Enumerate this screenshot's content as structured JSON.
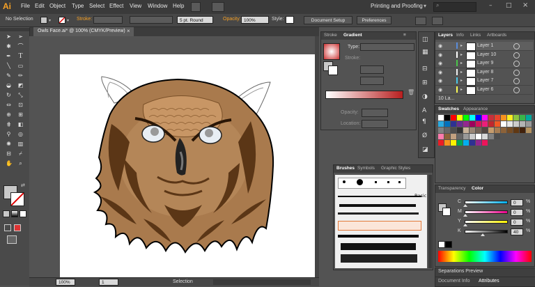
{
  "app": {
    "logo": "Ai"
  },
  "menu": [
    "File",
    "Edit",
    "Object",
    "Type",
    "Select",
    "Effect",
    "View",
    "Window",
    "Help"
  ],
  "workspace": {
    "label": "Printing and Proofing"
  },
  "control_bar": {
    "selection_label": "No Selection",
    "stroke_label": "Stroke:",
    "stroke_profile": "5 pt. Round",
    "opacity_label": "Opacity:",
    "opacity_value": "100%",
    "style_label": "Style:",
    "doc_setup": "Document Setup",
    "preferences": "Preferences"
  },
  "document": {
    "tab_title": "Owls Face.ai* @ 100% (CMYK/Preview)",
    "close": "×"
  },
  "status": {
    "zoom": "100%",
    "artboard": "1",
    "tool": "Selection"
  },
  "stroke_gradient_panel": {
    "tabs": [
      "Stroke",
      "Gradient"
    ],
    "type_label": "Type:",
    "stroke_label": "Stroke:",
    "opacity_label": "Opacity:",
    "location_label": "Location:"
  },
  "layers_panel": {
    "tabs": [
      "Layers",
      "Info",
      "Links",
      "Artboards"
    ],
    "layers": [
      "Layer 1",
      "Layer 10",
      "Layer 9",
      "Layer 8",
      "Layer 7",
      "Layer 6"
    ],
    "footer": "10 La..."
  },
  "swatches_panel": {
    "tabs": [
      "Swatches",
      "Appearance"
    ]
  },
  "brushes_panel": {
    "tabs": [
      "Brushes",
      "Symbols",
      "Graphic Styles"
    ],
    "basic_label": "Basic"
  },
  "color_panel": {
    "tabs": [
      "Transparency",
      "Color"
    ],
    "channels": [
      {
        "label": "C",
        "value": "0",
        "pct": "%",
        "fill": 0.0
      },
      {
        "label": "M",
        "value": "0",
        "pct": "%",
        "fill": 0.0
      },
      {
        "label": "Y",
        "value": "0",
        "pct": "%",
        "fill": 0.0
      },
      {
        "label": "K",
        "value": "40",
        "pct": "%",
        "fill": 0.4
      }
    ]
  },
  "separations": {
    "label": "Separations Preview"
  },
  "bottom_tabs": [
    "Document Info",
    "Attributes"
  ],
  "colors": {
    "accent": "#f7a125",
    "canvas": "#ffffff",
    "owl_brown": "#a97a4d",
    "owl_dark": "#5b3616"
  }
}
